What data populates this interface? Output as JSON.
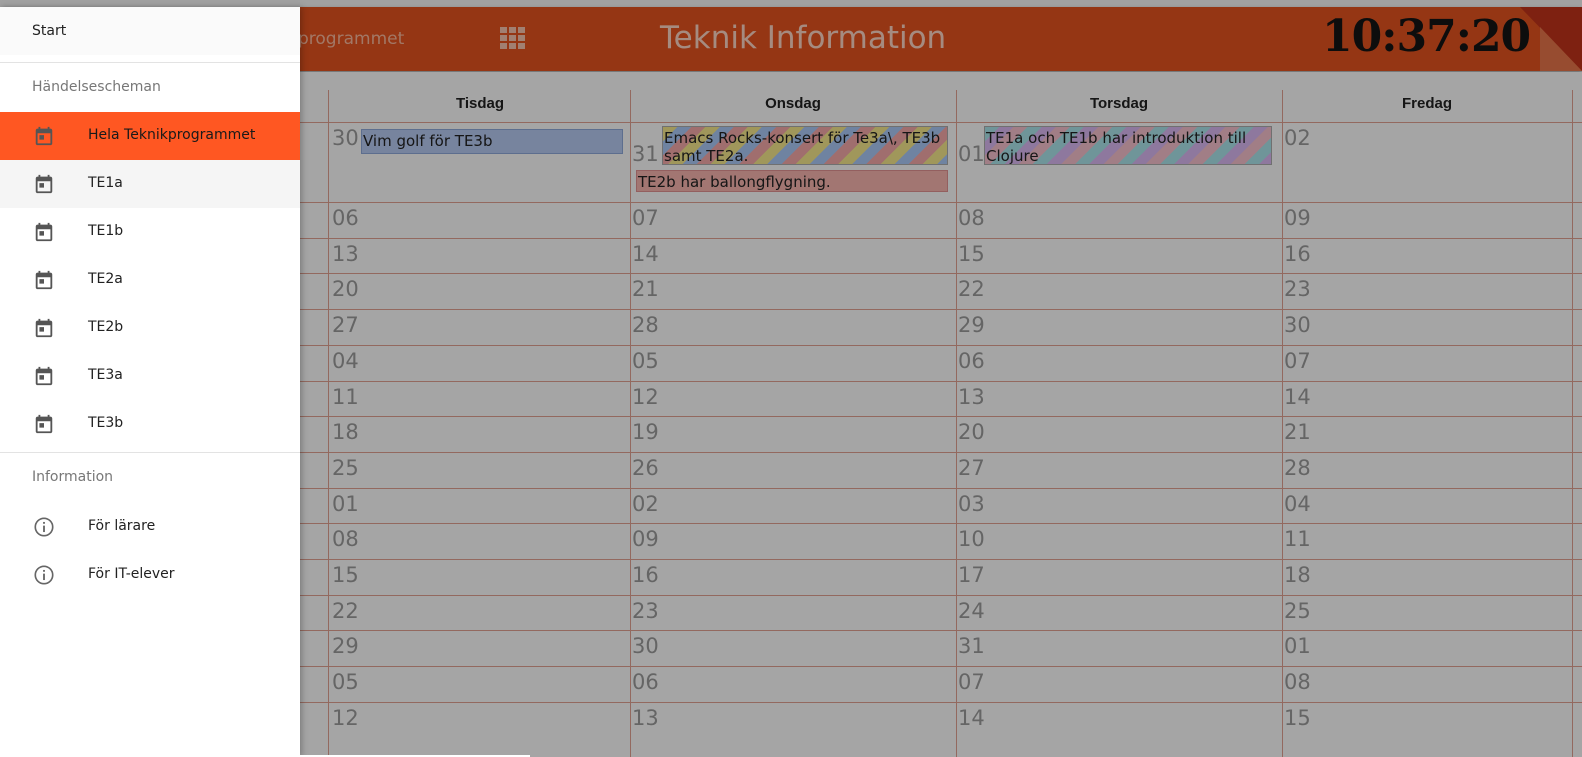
{
  "header": {
    "program_partial": "programmet",
    "apps_icon": "grid-icon",
    "title": "Teknik Information",
    "clock": "10:37:20",
    "color": "#e2531f"
  },
  "calendar": {
    "columns": [
      "Tisdag",
      "Onsdag",
      "Torsdag",
      "Fredag"
    ],
    "rows": [
      [
        "30",
        "31",
        "01",
        "02"
      ],
      [
        "06",
        "07",
        "08",
        "09"
      ],
      [
        "13",
        "14",
        "15",
        "16"
      ],
      [
        "20",
        "21",
        "22",
        "23"
      ],
      [
        "27",
        "28",
        "29",
        "30"
      ],
      [
        "04",
        "05",
        "06",
        "07"
      ],
      [
        "11",
        "12",
        "13",
        "14"
      ],
      [
        "18",
        "19",
        "20",
        "21"
      ],
      [
        "25",
        "26",
        "27",
        "28"
      ],
      [
        "01",
        "02",
        "03",
        "04"
      ],
      [
        "08",
        "09",
        "10",
        "11"
      ],
      [
        "15",
        "16",
        "17",
        "18"
      ],
      [
        "22",
        "23",
        "24",
        "25"
      ],
      [
        "29",
        "30",
        "31",
        "01"
      ],
      [
        "05",
        "06",
        "07",
        "08"
      ],
      [
        "12",
        "13",
        "14",
        "15"
      ]
    ],
    "events": {
      "tue": "Vim golf för TE3b",
      "wed1": "Emacs Rocks-konsert för Te3a\\, TE3b samt TE2a.",
      "wed2": "TE2b har ballongflygning.",
      "thu": "TE1a och TE1b har introduktion till Clojure"
    }
  },
  "drawer": {
    "start": "Start",
    "section1": "Händelsescheman",
    "items": [
      {
        "label": "Hela Teknikprogrammet",
        "icon": "calendar-icon",
        "active": true
      },
      {
        "label": "TE1a",
        "icon": "calendar-icon"
      },
      {
        "label": "TE1b",
        "icon": "calendar-icon"
      },
      {
        "label": "TE2a",
        "icon": "calendar-icon"
      },
      {
        "label": "TE2b",
        "icon": "calendar-icon"
      },
      {
        "label": "TE3a",
        "icon": "calendar-icon"
      },
      {
        "label": "TE3b",
        "icon": "calendar-icon"
      }
    ],
    "section2": "Information",
    "info_items": [
      {
        "label": "För lärare",
        "icon": "info-icon"
      },
      {
        "label": "För IT-elever",
        "icon": "info-icon"
      }
    ],
    "accent": "#ff5722"
  }
}
